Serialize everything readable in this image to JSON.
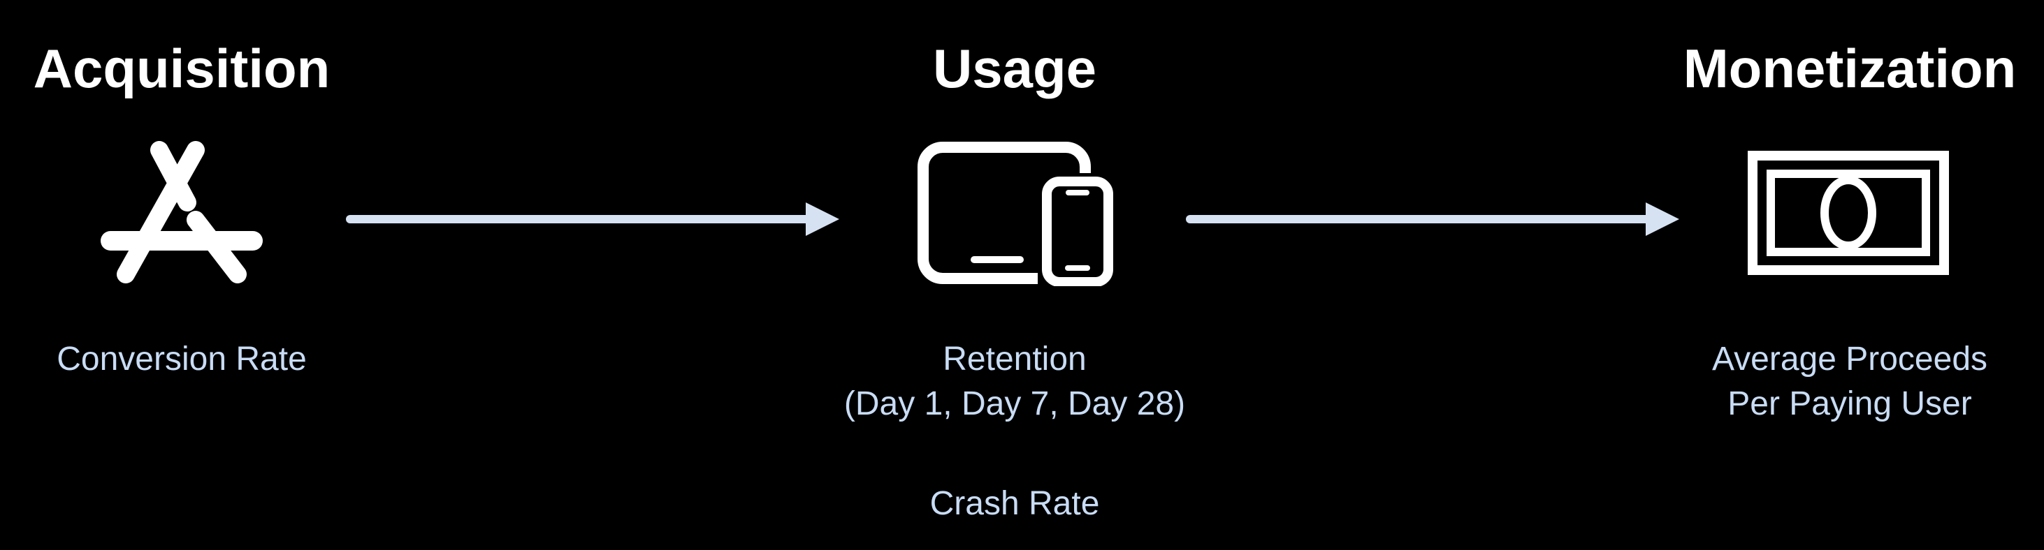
{
  "stages": [
    {
      "title": "Acquisition",
      "icon": "app-store-icon",
      "metrics": [
        {
          "lines": [
            "Conversion Rate"
          ]
        }
      ]
    },
    {
      "title": "Usage",
      "icon": "devices-icon",
      "metrics": [
        {
          "lines": [
            "Retention",
            "(Day 1, Day 7, Day 28)"
          ]
        },
        {
          "lines": [
            "Crash Rate"
          ]
        }
      ]
    },
    {
      "title": "Monetization",
      "icon": "banknote-icon",
      "metrics": [
        {
          "lines": [
            "Average Proceeds",
            "Per Paying User"
          ]
        }
      ]
    }
  ],
  "arrows": [
    {
      "from": "Acquisition",
      "to": "Usage"
    },
    {
      "from": "Usage",
      "to": "Monetization"
    }
  ],
  "colors": {
    "background": "#000000",
    "title": "#ffffff",
    "metric_text": "#c9dcf5",
    "arrow": "#d6e2f2",
    "icon": "#ffffff"
  }
}
